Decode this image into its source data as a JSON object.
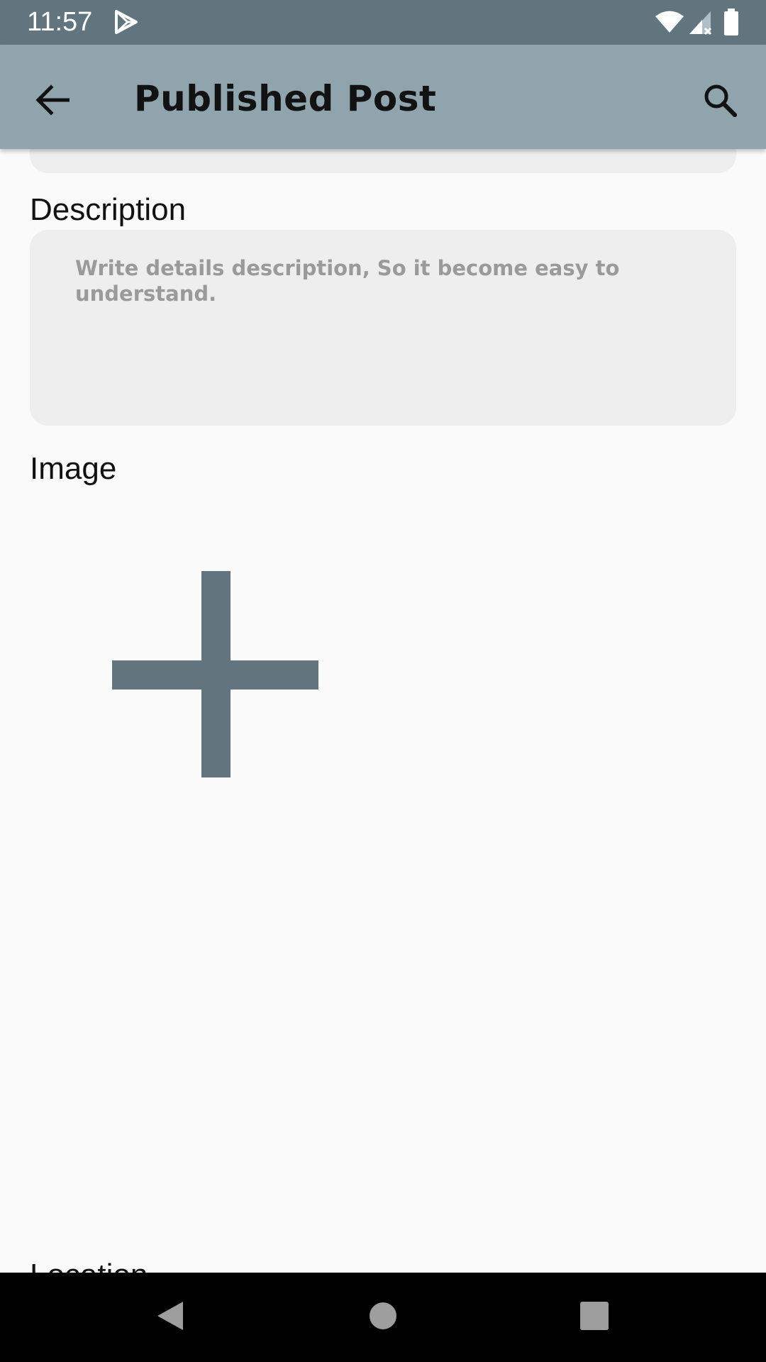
{
  "status_bar": {
    "time": "11:57",
    "icons": [
      "play-store-icon",
      "wifi-icon",
      "signal-icon",
      "battery-icon"
    ]
  },
  "app_bar": {
    "title": "Published Post",
    "back_icon": "arrow-back-icon",
    "search_icon": "search-icon"
  },
  "form": {
    "description": {
      "label": "Description",
      "placeholder": "Write details description, So it become easy to understand.",
      "value": ""
    },
    "image": {
      "label": "Image",
      "add_icon": "plus-icon"
    },
    "location": {
      "label": "Location"
    }
  },
  "nav_bar": {
    "icons": [
      "nav-back-icon",
      "nav-home-icon",
      "nav-recents-icon"
    ]
  },
  "colors": {
    "status_bar": "#62757f",
    "app_bar": "#90a4ae",
    "background": "#fafafa",
    "field_background": "#eeeeee",
    "accent": "#62757f",
    "placeholder_text": "#9a9a9a"
  }
}
